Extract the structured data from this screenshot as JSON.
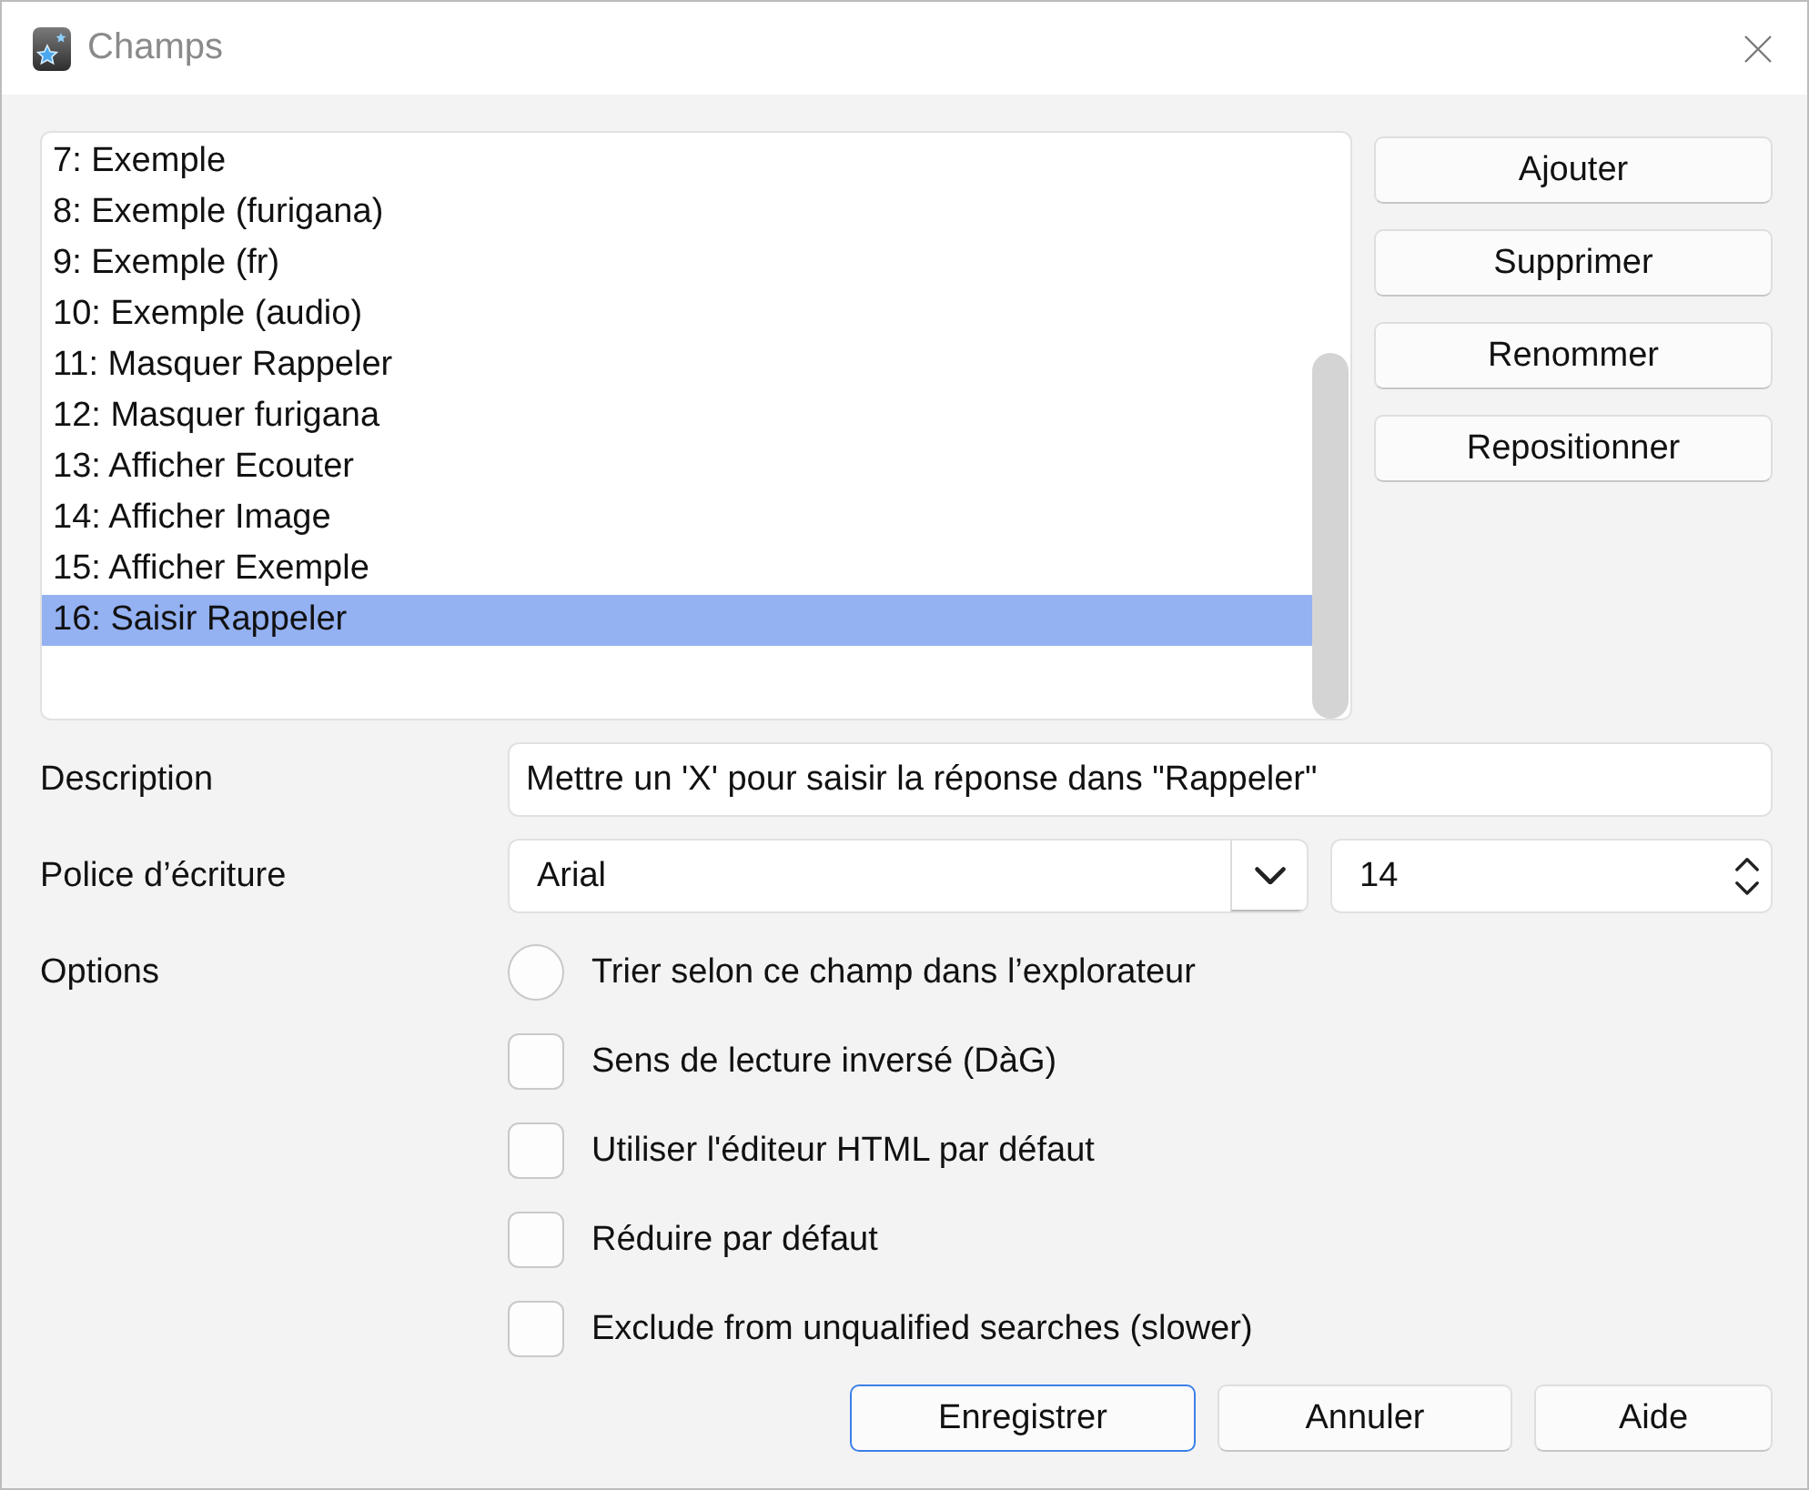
{
  "window": {
    "title": "Champs"
  },
  "field_list": {
    "items": [
      {
        "label": "7: Exemple",
        "selected": false
      },
      {
        "label": "8: Exemple (furigana)",
        "selected": false
      },
      {
        "label": "9: Exemple (fr)",
        "selected": false
      },
      {
        "label": "10: Exemple (audio)",
        "selected": false
      },
      {
        "label": "11: Masquer Rappeler",
        "selected": false
      },
      {
        "label": "12: Masquer furigana",
        "selected": false
      },
      {
        "label": "13: Afficher Ecouter",
        "selected": false
      },
      {
        "label": "14: Afficher Image",
        "selected": false
      },
      {
        "label": "15: Afficher Exemple",
        "selected": false
      },
      {
        "label": "16: Saisir Rappeler",
        "selected": true
      }
    ]
  },
  "field_buttons": [
    "Ajouter",
    "Supprimer",
    "Renommer",
    "Repositionner"
  ],
  "description": {
    "label": "Description",
    "value": "Mettre un 'X' pour saisir la réponse dans \"Rappeler\""
  },
  "font": {
    "label": "Police d’écriture",
    "family": "Arial",
    "size": "14"
  },
  "options": {
    "label": "Options",
    "items": [
      {
        "kind": "radio",
        "label": "Trier selon ce champ dans l’explorateur",
        "checked": false
      },
      {
        "kind": "checkbox",
        "label": "Sens de lecture inversé (DàG)",
        "checked": false
      },
      {
        "kind": "checkbox",
        "label": "Utiliser l'éditeur HTML par défaut",
        "checked": false
      },
      {
        "kind": "checkbox",
        "label": "Réduire par défaut",
        "checked": false
      },
      {
        "kind": "checkbox",
        "label": "Exclude from unqualified searches (slower)",
        "checked": false
      }
    ]
  },
  "buttons": [
    {
      "label": "Enregistrer",
      "focused": true
    },
    {
      "label": "Annuler",
      "focused": false
    },
    {
      "label": "Aide",
      "focused": false
    }
  ]
}
